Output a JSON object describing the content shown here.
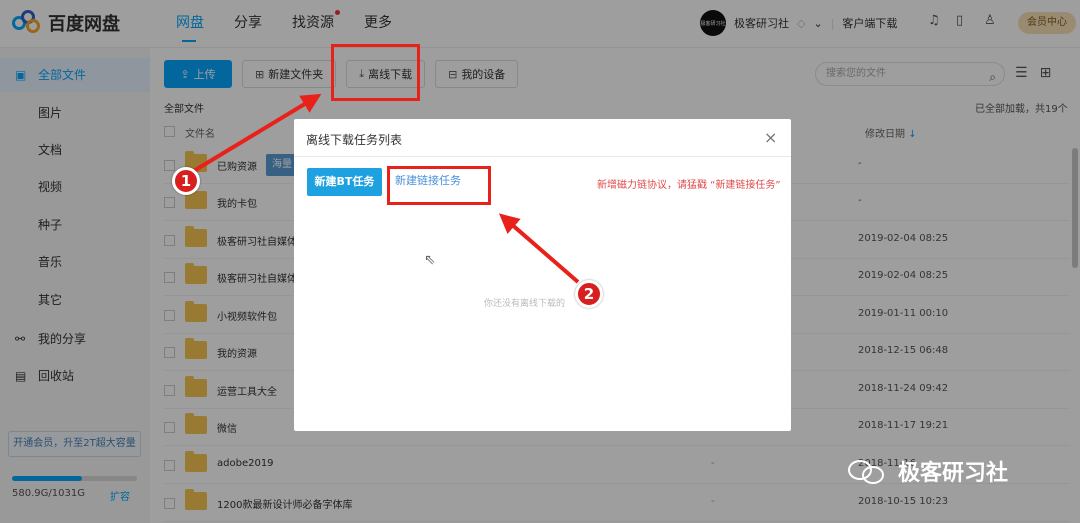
{
  "header": {
    "logo_text": "百度网盘",
    "nav": [
      "网盘",
      "分享",
      "找资源",
      "更多"
    ],
    "avatar_text": "极客研习社",
    "username": "极客研习社",
    "client_download": "客户端下载",
    "vip_center": "会员中心"
  },
  "sidebar": {
    "all_files": "全部文件",
    "categories": [
      "图片",
      "文档",
      "视频",
      "种子",
      "音乐",
      "其它"
    ],
    "my_share": "我的分享",
    "recycle": "回收站",
    "vip_promo": "开通会员，升至2T超大容量",
    "storage_text": "580.9G/1031G",
    "storage_fraction": 0.56,
    "expand": "扩容"
  },
  "toolbar": {
    "upload": "上传",
    "new_folder": "新建文件夹",
    "offline_download": "离线下载",
    "my_devices": "我的设备",
    "search_placeholder": "搜索您的文件"
  },
  "list": {
    "breadcrumb": "全部文件",
    "loaded_info": "已全部加载，共19个",
    "col_name": "文件名",
    "col_date": "修改日期",
    "tooltip": "海量",
    "rows": [
      {
        "name": "已购资源",
        "size": "",
        "date": "-"
      },
      {
        "name": "我的卡包",
        "size": "",
        "date": "-"
      },
      {
        "name": "极客研习社自媒体",
        "size": "",
        "date": "2019-02-04 08:25"
      },
      {
        "name": "极客研习社自媒体",
        "size": "",
        "date": "2019-02-04 08:25"
      },
      {
        "name": "小视频软件包",
        "size": "",
        "date": "2019-01-11 00:10"
      },
      {
        "name": "我的资源",
        "size": "",
        "date": "2018-12-15 06:48"
      },
      {
        "name": "运营工具大全",
        "size": "",
        "date": "2018-11-24 09:42"
      },
      {
        "name": "微信",
        "size": "",
        "date": "2018-11-17 19:21"
      },
      {
        "name": "adobe2019",
        "size": "-",
        "date": "2018-11-16"
      },
      {
        "name": "1200款最新设计师必备字体库",
        "size": "-",
        "date": "2018-10-15 10:23"
      }
    ]
  },
  "modal": {
    "title": "离线下载任务列表",
    "close": "×",
    "bt_task": "新建BT任务",
    "link_task": "新建链接任务",
    "magnet_note": "新增磁力链协议，请猛戳 “新建链接任务”",
    "empty_msg": "你还没有离线下载的"
  },
  "annotations": {
    "badge1": "1",
    "badge2": "2",
    "color": "#e8221b"
  },
  "watermark": {
    "text": "极客研习社"
  }
}
